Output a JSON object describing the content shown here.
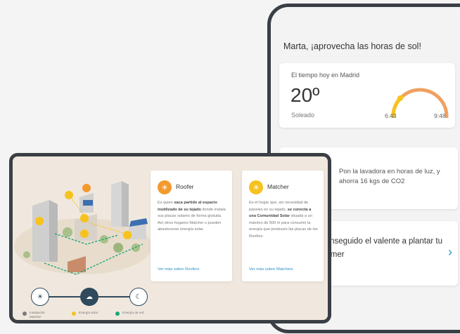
{
  "phone": {
    "greeting": "Marta, ¡aprovecha las horas de sol!",
    "weather": {
      "label": "El tiempo hoy en Madrid",
      "temp": "20º",
      "condition": "Soleado",
      "sunrise": "6:43",
      "sunset": "9:48"
    },
    "tip": {
      "text": "Pon la lavadora en horas de luz, y ahorra 16 kgs de CO2"
    },
    "goal": {
      "text": "conseguido el valente a plantar tu primer"
    }
  },
  "tablet": {
    "roofer": {
      "title": "Roofer",
      "body_pre": "Es quien ",
      "body_bold": "saca partido al espacio inutilizado de su tejado",
      "body_post": " donde instala sus placas solares de forma gratuita. Así otros hogares Matcher s pueden abastecerse energía solar.",
      "link": "Ver más sobre Roofers"
    },
    "matcher": {
      "title": "Matcher",
      "body_pre": "Es el hogar que, sin necesidad de paneles en su tejado, ",
      "body_bold": "se conecta a una Comunidad Solar",
      "body_post": " situada a un máximo de 500 m para consumir la energía que producen las placas de los Roofers",
      "link": "Ver más sobre Matchers"
    },
    "legend": {
      "item1": "Instalación Matcher",
      "item2": "Energía solar",
      "item3": "Energía de red"
    }
  },
  "colors": {
    "roofer_accent": "#f39a2e",
    "matcher_accent": "#f7c21c",
    "link": "#2a8fc5",
    "grid_green": "#1aa87a",
    "bezel": "#3a3f45"
  }
}
